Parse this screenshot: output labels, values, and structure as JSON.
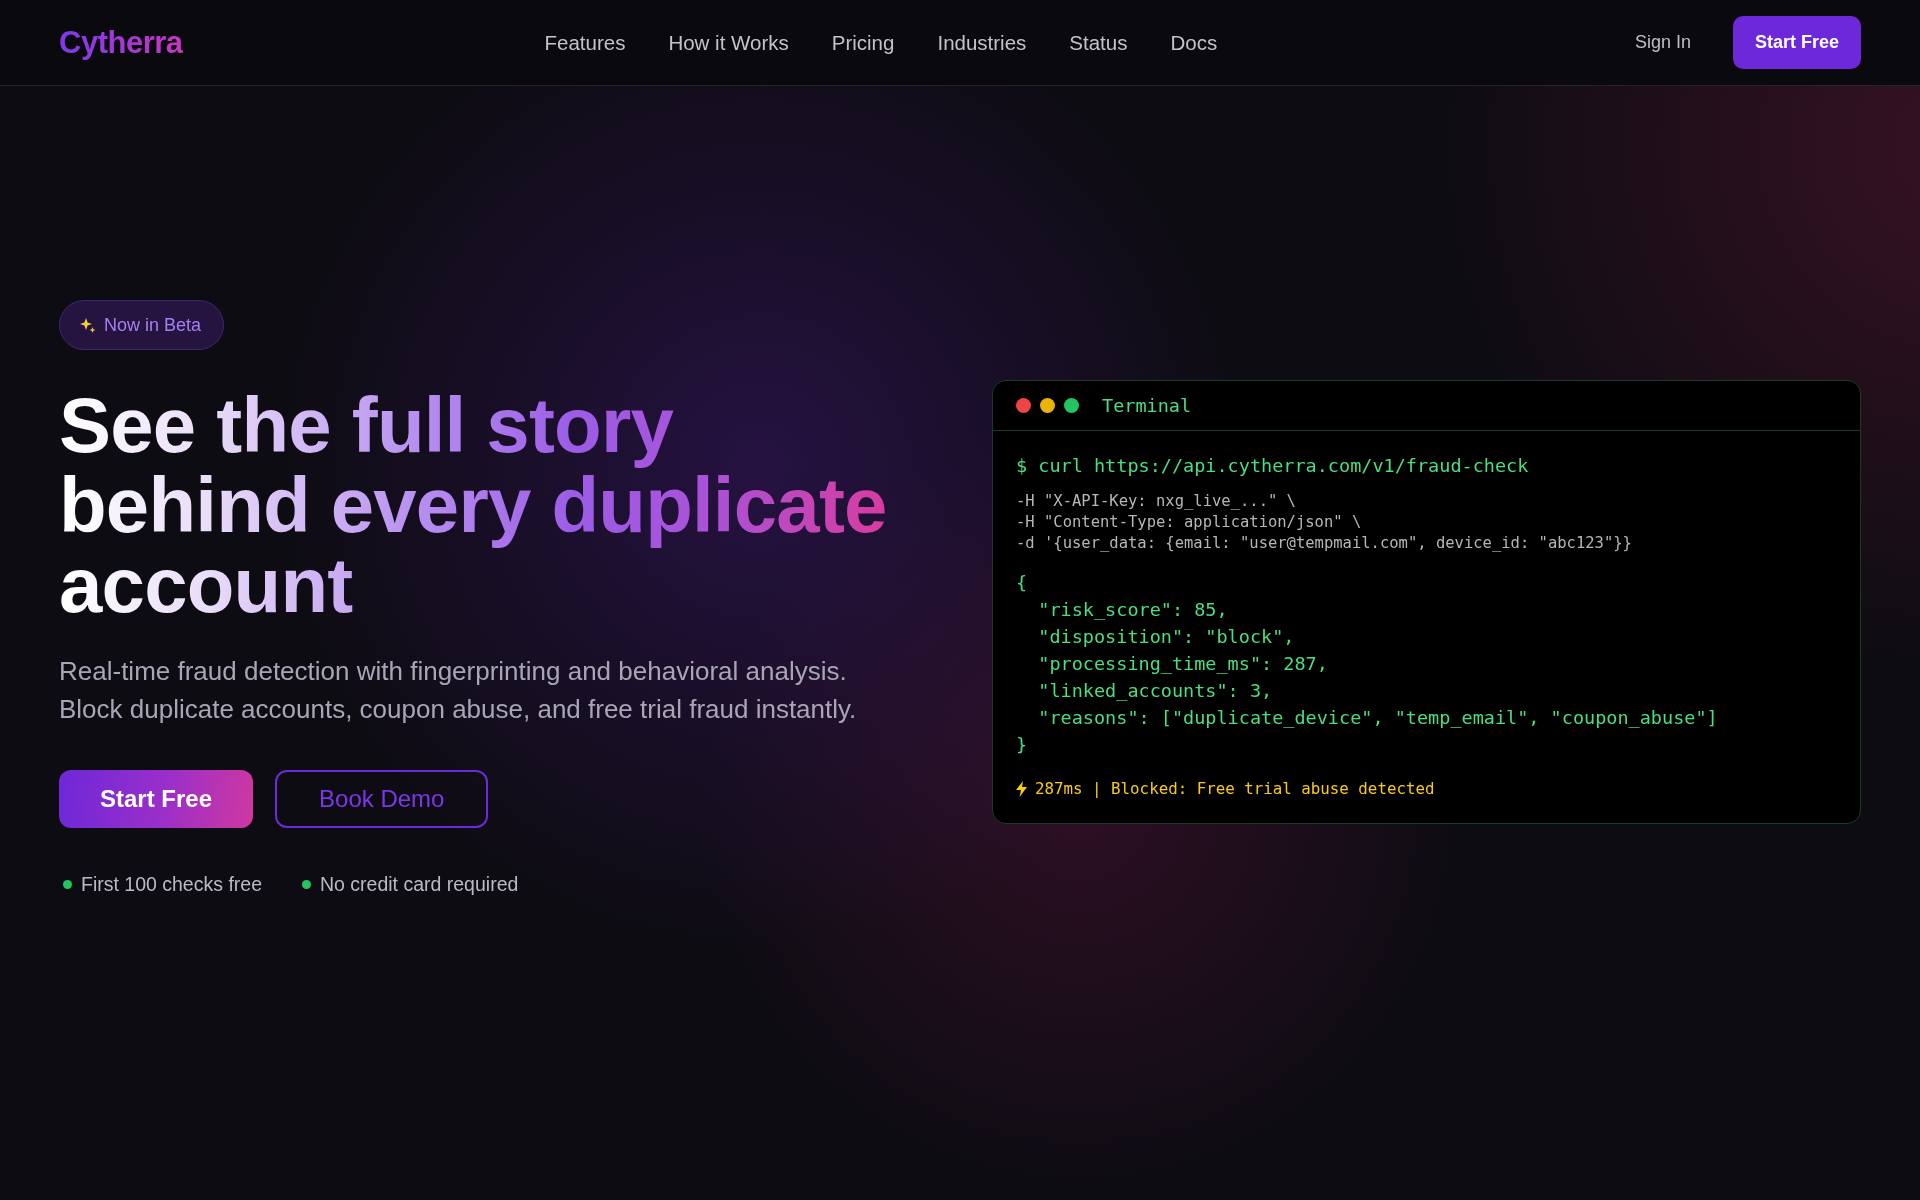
{
  "nav": {
    "logo": "Cytherra",
    "links": [
      "Features",
      "How it Works",
      "Pricing",
      "Industries",
      "Status",
      "Docs"
    ],
    "sign_in": "Sign In",
    "cta": "Start Free"
  },
  "hero": {
    "badge": "Now in Beta",
    "headline_lines": [
      "See the full story",
      "behind every duplicate",
      "account"
    ],
    "subtitle_lines": [
      "Real-time fraud detection with fingerprinting and behavioral analysis.",
      "Block duplicate accounts, coupon abuse, and free trial fraud instantly."
    ],
    "buttons": [
      {
        "label": "Start Free",
        "kind": "primary"
      },
      {
        "label": "Book Demo",
        "kind": "outline"
      }
    ],
    "perks": [
      "First 100 checks free",
      "No credit card required"
    ]
  },
  "terminal": {
    "title": "Terminal",
    "command": "$ curl https://api.cytherra.com/v1/fraud-check",
    "options": [
      "-H \"X-API-Key: nxg_live_...\" \\",
      "-H \"Content-Type: application/json\" \\",
      "-d '{user_data: {email: \"user@tempmail.com\", device_id: \"abc123\"}}"
    ],
    "response": [
      "{",
      "  \"risk_score\": 85,",
      "  \"disposition\": \"block\",",
      "  \"processing_time_ms\": 287,",
      "  \"linked_accounts\": 3,",
      "  \"reasons\": [\"duplicate_device\", \"temp_email\", \"coupon_abuse\"]",
      "}"
    ],
    "status": "287ms | Blocked: Free trial abuse detected"
  }
}
